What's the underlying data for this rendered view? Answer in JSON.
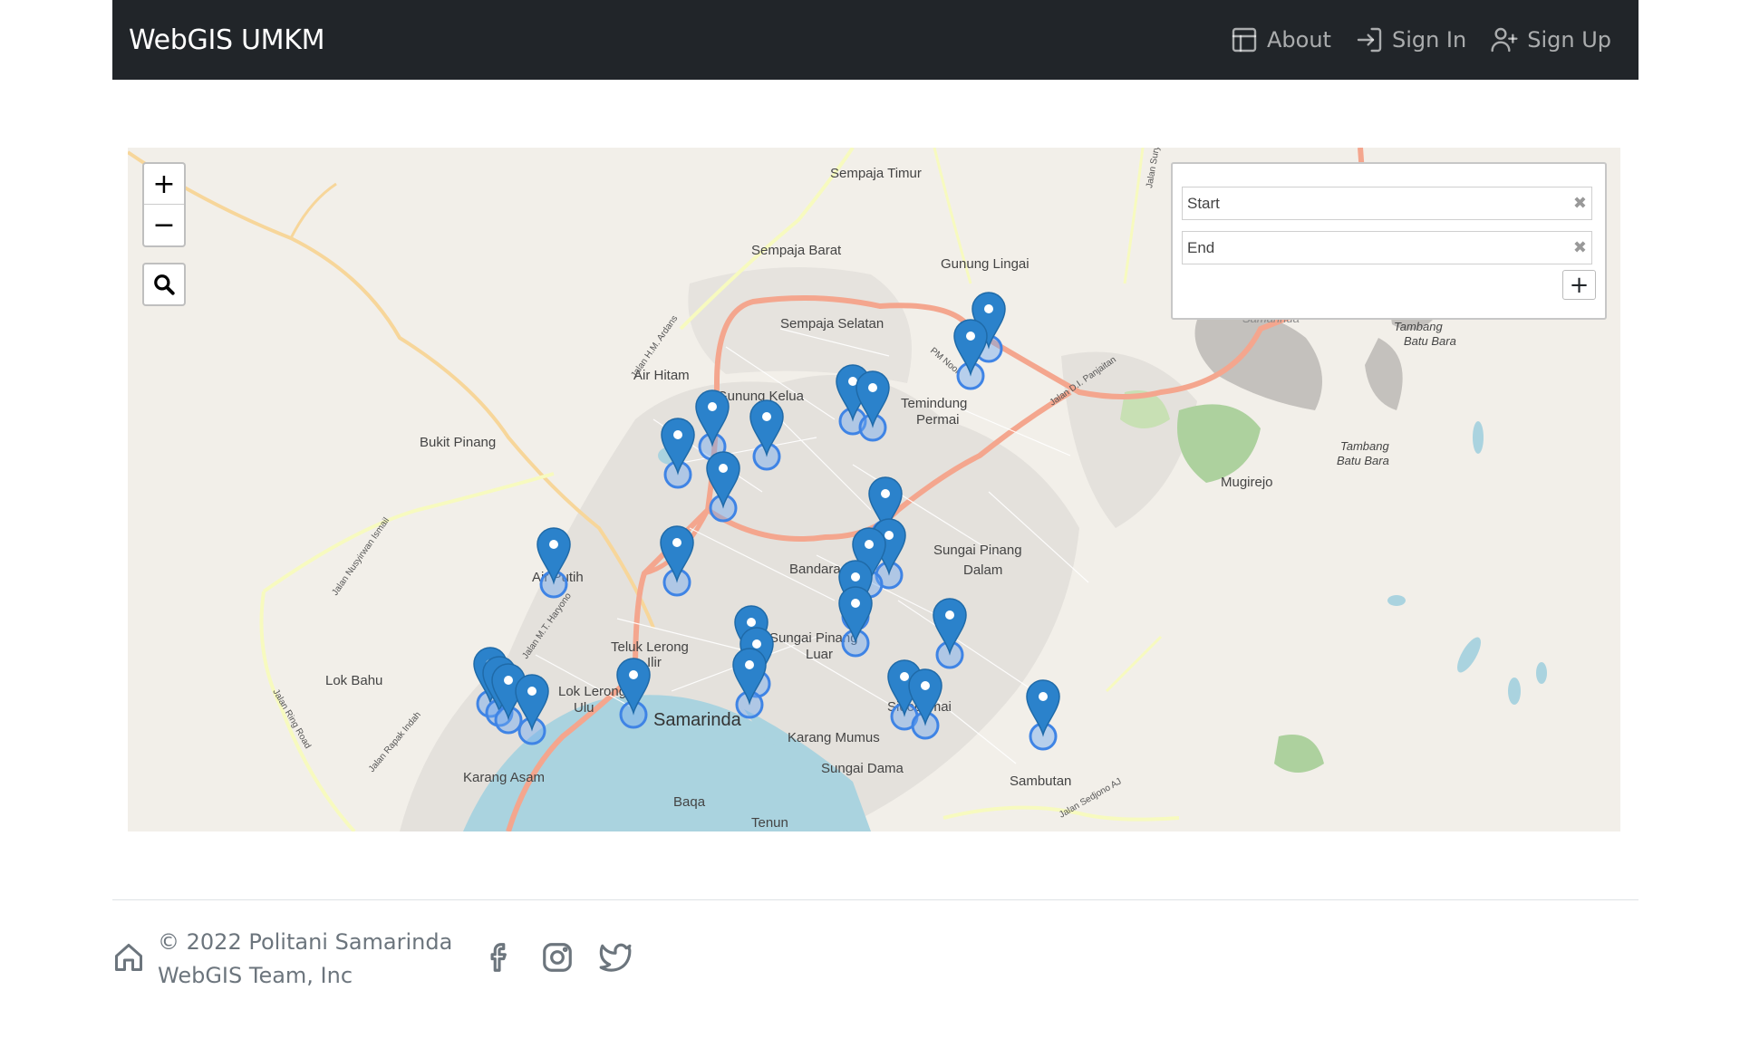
{
  "navbar": {
    "brand": "WebGIS UMKM",
    "links": [
      {
        "label": "About",
        "icon": "layout-icon"
      },
      {
        "label": "Sign In",
        "icon": "sign-in-icon"
      },
      {
        "label": "Sign Up",
        "icon": "person-plus-icon"
      }
    ]
  },
  "map": {
    "zoom_in": "+",
    "zoom_out": "−",
    "search_icon": "search-icon",
    "routing": {
      "start_placeholder": "Start",
      "end_placeholder": "End",
      "clear_glyph": "✖",
      "add_label": "+"
    },
    "labels": [
      "Sempaja Timur",
      "Sempaja Barat",
      "Gunung Lingai",
      "Sempaja Selatan",
      "Air Hitam",
      "Gunung Kelua",
      "Temindung",
      "Permai",
      "Bukit Pinang",
      "Mugirejo",
      "Tambang",
      "Batu Bara",
      "Bandara",
      "Sungai Pinang",
      "Dalam",
      "Air Putih",
      "Sungai Pinang",
      "Luar",
      "Teluk Lerong",
      "Ilir",
      "Sidodamai",
      "Lok Bahu",
      "Lok Lerong",
      "Ulu",
      "Samarinda",
      "Karang Mumus",
      "Sungai Dama",
      "Sambutan",
      "Baqa",
      "Tenun",
      "Karang Asam",
      "Tambang",
      "Batu Bara",
      "Samarinda"
    ],
    "road_labels": [
      "Jalan H.M. Ardans",
      "PM Noor",
      "Jalan D.I. Panjaitan",
      "Jalan Nusyirwan Ismail",
      "Jalan M.T. Haryono",
      "Jalan Ring Road",
      "Jalan Rapak Indah",
      "Jalan Sedjono AJ",
      "Jalan Suryanata"
    ]
  },
  "footer": {
    "copyright_line1": "© 2022 Politani Samarinda",
    "copyright_line2": "WebGIS Team, Inc",
    "social": [
      "facebook-icon",
      "instagram-icon",
      "twitter-icon"
    ]
  },
  "colors": {
    "navbar_bg": "#212529",
    "marker": "#2b82cb",
    "road_main": "#f4a68e",
    "road_secondary": "#f7d69a",
    "water": "#aad3df"
  }
}
